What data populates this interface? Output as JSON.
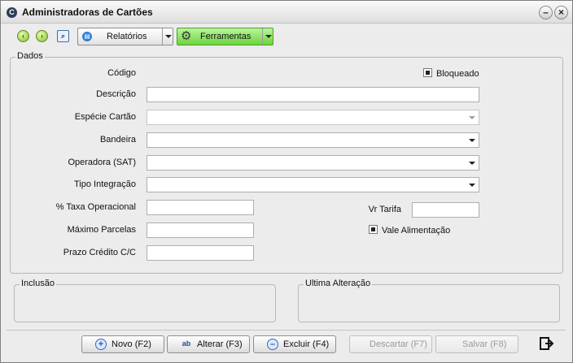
{
  "window": {
    "title": "Administradoras de Cartões"
  },
  "toolbar": {
    "relatorios_label": "Relatórios",
    "ferramentas_label": "Ferramentas"
  },
  "dados": {
    "group_label": "Dados",
    "codigo_label": "Código",
    "bloqueado_label": "Bloqueado",
    "bloqueado_checked": true,
    "descricao_label": "Descrição",
    "descricao_value": "",
    "especie_label": "Espécie Cartão",
    "especie_value": "",
    "bandeira_label": "Bandeira",
    "bandeira_value": "",
    "operadora_label": "Operadora (SAT)",
    "operadora_value": "",
    "tipo_integracao_label": "Tipo Integração",
    "tipo_integracao_value": "",
    "taxa_label": "% Taxa Operacional",
    "taxa_value": "",
    "vr_tarifa_label": "Vr Tarifa",
    "vr_tarifa_value": "",
    "max_parcelas_label": "Máximo Parcelas",
    "max_parcelas_value": "",
    "vale_alimentacao_label": "Vale Alimentação",
    "vale_alimentacao_checked": true,
    "prazo_label": "Prazo Crédito C/C",
    "prazo_value": ""
  },
  "inclusao": {
    "label": "Inclusão"
  },
  "ultima_alteracao": {
    "label": "Ultima Alteração"
  },
  "footer": {
    "novo_label": "Novo (F2)",
    "alterar_label": "Alterar (F3)",
    "excluir_label": "Excluir (F4)",
    "descartar_label": "Descartar (F7)",
    "salvar_label": "Salvar (F8)"
  },
  "colors": {
    "accent_green": "#6ed43e",
    "window_bg": "#ececec"
  }
}
